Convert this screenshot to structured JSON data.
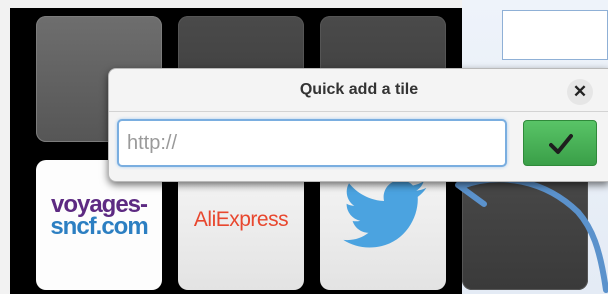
{
  "dialog": {
    "title": "Quick add a tile",
    "url_placeholder": "http://",
    "url_value": "",
    "close_icon": "close-icon",
    "confirm_icon": "check-icon"
  },
  "tiles": [
    {
      "id": "tile-empty-1",
      "type": "empty"
    },
    {
      "id": "tile-empty-2",
      "type": "empty"
    },
    {
      "id": "tile-empty-3",
      "type": "empty"
    },
    {
      "id": "tile-voyages",
      "type": "logo",
      "logo_line1": "voyages-",
      "logo_line2": "sncf.com"
    },
    {
      "id": "tile-aliexpress",
      "type": "logo",
      "logo_text": "AliExpress"
    },
    {
      "id": "tile-twitter",
      "type": "logo",
      "icon": "twitter-bird-icon"
    },
    {
      "id": "tile-empty-4",
      "type": "empty"
    }
  ],
  "annotation": {
    "icon": "hand-drawn-arrow",
    "color": "#5b92cc"
  },
  "colors": {
    "confirm_green": "#3a9f48",
    "input_focus_border": "#7aaee0",
    "aliexpress_orange": "#e8472e",
    "twitter_blue": "#4ba3e0"
  }
}
